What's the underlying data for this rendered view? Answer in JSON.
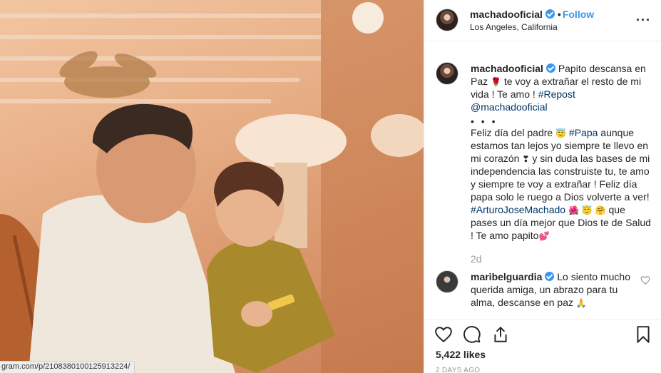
{
  "photo": {
    "status_url": "gram.com/p/2108380100125913224/"
  },
  "header": {
    "username": "machadooficial",
    "separator": "•",
    "follow_label": "Follow",
    "location": "Los Angeles, California",
    "more_icon": "more-options-icon"
  },
  "caption": {
    "username": "machadooficial",
    "line1": "Papito descansa en Paz",
    "line2": "te voy a extrañar el resto de mi vida ! Te amo !",
    "hashtag1": "#Repost",
    "mention": "@machadooficial",
    "dots": "• • •",
    "line3": "Feliz día del padre",
    "hashtag2": "#Papa",
    "line4": "aunque estamos tan lejos yo siempre te llevo en mi corazón",
    "line5": "y sin duda las bases de mi independencia las construiste tu, te amo y siempre te voy a extrañar ! Feliz día papa solo le ruego a Dios volverte a ver!",
    "hashtag3": "#ArturoJoseMachado",
    "line6": "que pases un día mejor que Dios te de Salud ! Te amo papito",
    "emoji_rose": "🌹",
    "emoji_face": "😇",
    "emoji_heart_small": "❣",
    "emoji_hibiscus": "🌺",
    "emoji_face2": "😇",
    "emoji_face3": "🤗",
    "emoji_heart": "💕"
  },
  "caption_age": "2d",
  "reply": {
    "username": "maribelguardia",
    "text": "Lo siento mucho querida amiga, un abrazo para tu alma, descanse en paz",
    "emoji": "🙏"
  },
  "actions": {
    "likes": "5,422 likes",
    "timestamp": "2 DAYS AGO"
  },
  "colors": {
    "link_blue": "#3897f0",
    "hashtag": "#003569",
    "muted": "#999999",
    "text": "#262626"
  }
}
